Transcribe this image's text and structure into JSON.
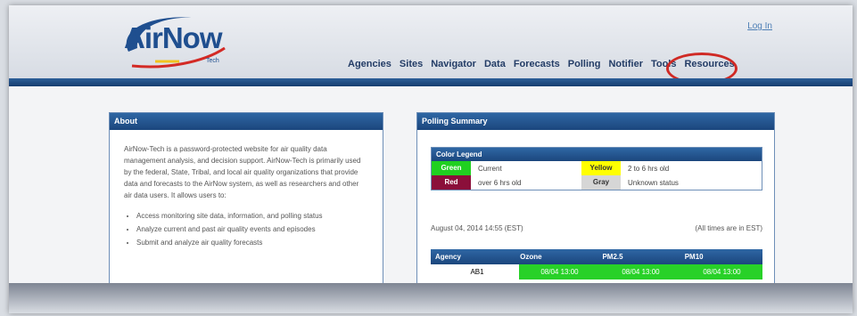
{
  "header": {
    "logo": "AirNow",
    "logo_sub": "Tech",
    "login": "Log In"
  },
  "nav": [
    {
      "label": "Agencies"
    },
    {
      "label": "Sites"
    },
    {
      "label": "Navigator"
    },
    {
      "label": "Data"
    },
    {
      "label": "Forecasts"
    },
    {
      "label": "Polling"
    },
    {
      "label": "Notifier"
    },
    {
      "label": "Tools"
    },
    {
      "label": "Resources"
    }
  ],
  "about": {
    "title": "About",
    "paragraph": "AirNow-Tech is a password-protected website for air quality data management analysis, and decision support. AirNow-Tech is primarily used by the federal, State, Tribal, and local air quality organizations that provide data and forecasts to the AirNow system, as well as researchers and other air data users. It allows users to:",
    "bullets": [
      "Access monitoring site data, information, and polling status",
      "Analyze current and past air quality events and episodes",
      "Submit and analyze air quality forecasts"
    ]
  },
  "polling": {
    "title": "Polling Summary",
    "legend": {
      "title": "Color Legend",
      "items": [
        {
          "swatch": "Green",
          "desc": "Current",
          "color": "#20d020",
          "text_color": "#ffffff"
        },
        {
          "swatch": "Yellow",
          "desc": "2 to 6 hrs old",
          "color": "#ffff00",
          "text_color": "#333333"
        },
        {
          "swatch": "Red",
          "desc": "over 6 hrs old",
          "color": "#8b0f3a",
          "text_color": "#ffffff"
        },
        {
          "swatch": "Gray",
          "desc": "Unknown status",
          "color": "#d6d6d6",
          "text_color": "#333333"
        }
      ]
    },
    "date": "August 04, 2014 14:55 (EST)",
    "times_note": "(All times are in EST)",
    "table": {
      "headers": [
        "Agency",
        "Ozone",
        "PM2.5",
        "PM10"
      ],
      "rows": [
        [
          "AB1",
          "08/04 13:00",
          "08/04 13:00",
          "08/04 13:00"
        ]
      ]
    }
  }
}
